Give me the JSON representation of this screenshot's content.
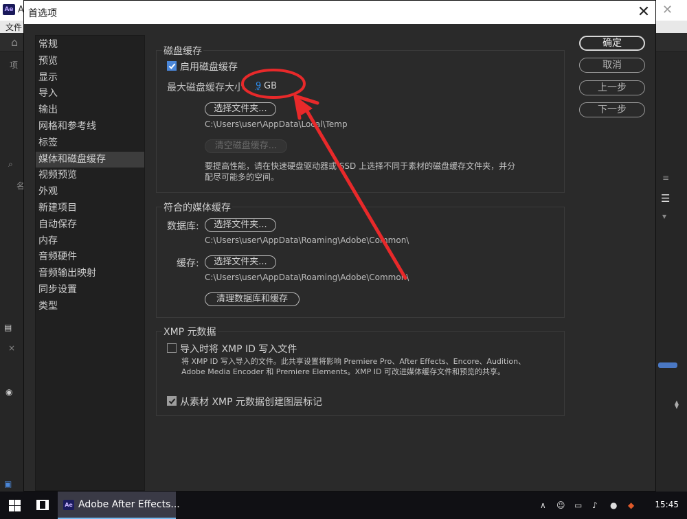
{
  "background_app": {
    "logo": "Ae",
    "title_fragment": "A",
    "menu_fragment": "文件",
    "side_glyph_1": "项",
    "side_glyph_2": "名"
  },
  "dialog": {
    "title": "首选项"
  },
  "nav": {
    "items": [
      "常规",
      "预览",
      "显示",
      "导入",
      "输出",
      "网格和参考线",
      "标签",
      "媒体和磁盘缓存",
      "视频预览",
      "外观",
      "新建项目",
      "自动保存",
      "内存",
      "音频硬件",
      "音频输出映射",
      "同步设置",
      "类型"
    ],
    "active_index": 7
  },
  "disk_cache": {
    "legend": "磁盘缓存",
    "enable_label": "启用磁盘缓存",
    "enable_checked": true,
    "max_size_label": "最大磁盘缓存大小",
    "max_size_value": "9",
    "max_size_unit": "GB",
    "choose_folder_button": "选择文件夹...",
    "folder_path": "C:\\Users\\user\\AppData\\Local\\Temp",
    "empty_cache_button": "清空磁盘缓存...",
    "note_line1": "要提高性能，请在快速硬盘驱动器或 SSD 上选择不同于素材的磁盘缓存文件夹，并分",
    "note_line2": "配尽可能多的空间。"
  },
  "media_cache": {
    "legend": "符合的媒体缓存",
    "database_label": "数据库:",
    "database_button": "选择文件夹...",
    "database_path": "C:\\Users\\user\\AppData\\Roaming\\Adobe\\Common\\",
    "cache_label": "缓存:",
    "cache_button": "选择文件夹...",
    "cache_path": "C:\\Users\\user\\AppData\\Roaming\\Adobe\\Common\\",
    "clean_button": "清理数据库和缓存"
  },
  "xmp": {
    "legend": "XMP 元数据",
    "write_id_label": "导入时将 XMP ID 写入文件",
    "write_id_checked": false,
    "note_line1": "将 XMP ID 写入导入的文件。此共享设置将影响 Premiere Pro、After Effects、Encore、Audition、",
    "note_line2": "Adobe Media Encoder 和 Premiere Elements。XMP ID 可改进媒体缓存文件和预览的共享。",
    "create_markers_label": "从素材 XMP 元数据创建图层标记",
    "create_markers_checked": true
  },
  "buttons": {
    "ok": "确定",
    "cancel": "取消",
    "previous": "上一步",
    "next": "下一步"
  },
  "taskbar": {
    "app_label": "Adobe After Effects...",
    "clock": "15:45"
  },
  "colors": {
    "annotation_red": "#e8292a",
    "value_blue": "#2d8ceb"
  }
}
